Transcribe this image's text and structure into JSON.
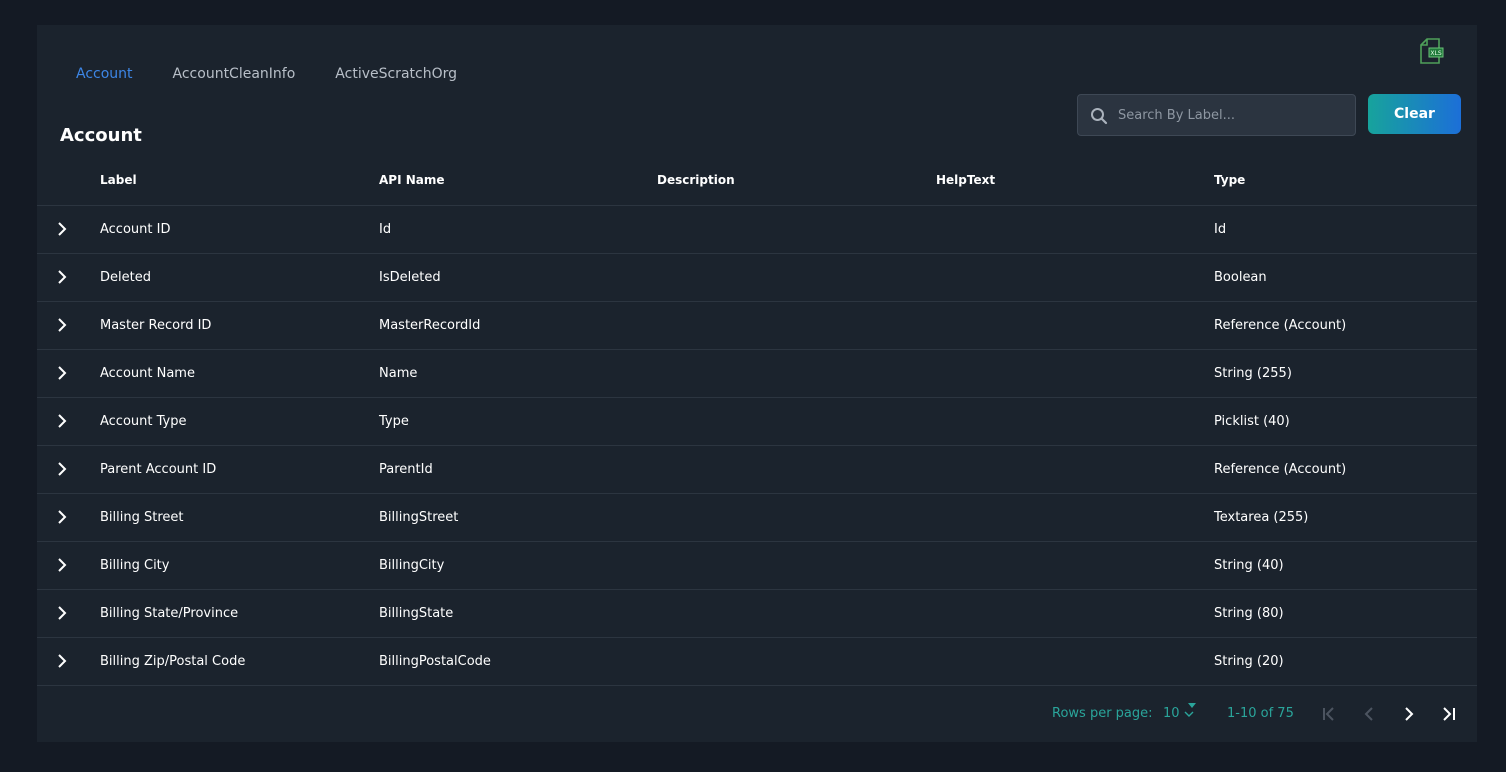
{
  "tabs": [
    {
      "label": "Account",
      "active": true
    },
    {
      "label": "AccountCleanInfo",
      "active": false
    },
    {
      "label": "ActiveScratchOrg",
      "active": false
    }
  ],
  "page_title": "Account",
  "search": {
    "placeholder": "Search By Label...",
    "value": ""
  },
  "clear_label": "Clear",
  "columns": [
    "Label",
    "API Name",
    "Description",
    "HelpText",
    "Type"
  ],
  "rows": [
    {
      "label": "Account ID",
      "api": "Id",
      "description": "",
      "helptext": "",
      "type": "Id"
    },
    {
      "label": "Deleted",
      "api": "IsDeleted",
      "description": "",
      "helptext": "",
      "type": "Boolean"
    },
    {
      "label": "Master Record ID",
      "api": "MasterRecordId",
      "description": "",
      "helptext": "",
      "type": "Reference (Account)"
    },
    {
      "label": "Account Name",
      "api": "Name",
      "description": "",
      "helptext": "",
      "type": "String (255)"
    },
    {
      "label": "Account Type",
      "api": "Type",
      "description": "",
      "helptext": "",
      "type": "Picklist (40)"
    },
    {
      "label": "Parent Account ID",
      "api": "ParentId",
      "description": "",
      "helptext": "",
      "type": "Reference (Account)"
    },
    {
      "label": "Billing Street",
      "api": "BillingStreet",
      "description": "",
      "helptext": "",
      "type": "Textarea (255)"
    },
    {
      "label": "Billing City",
      "api": "BillingCity",
      "description": "",
      "helptext": "",
      "type": "String (40)"
    },
    {
      "label": "Billing State/Province",
      "api": "BillingState",
      "description": "",
      "helptext": "",
      "type": "String (80)"
    },
    {
      "label": "Billing Zip/Postal Code",
      "api": "BillingPostalCode",
      "description": "",
      "helptext": "",
      "type": "String (20)"
    }
  ],
  "pagination": {
    "rows_per_page_label": "Rows per page:",
    "rows_per_page_value": "10",
    "range_text": "1-10 of 75"
  },
  "icons": {
    "export": "excel-export-icon",
    "search": "search-icon",
    "expand": "chevron-right-icon",
    "first": "first-page-icon",
    "prev": "previous-page-icon",
    "next": "next-page-icon",
    "last": "last-page-icon"
  },
  "colors": {
    "background": "#141a24",
    "panel": "#1b232d",
    "accent_tab": "#3d86e6",
    "teal": "#2aa59b",
    "clear_gradient_start": "#17a39c",
    "clear_gradient_end": "#1c6fd8"
  }
}
